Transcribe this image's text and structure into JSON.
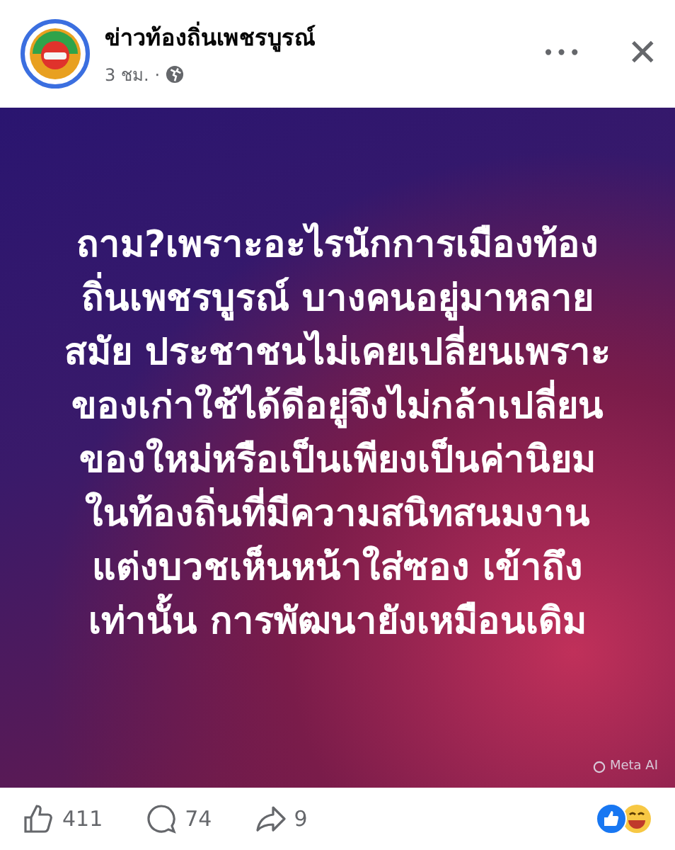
{
  "post": {
    "author": "ข่าวท้องถิ่นเพชรบูรณ์",
    "time": "3 ชม.",
    "separator": "·",
    "more": "•••",
    "close": "✕"
  },
  "image": {
    "lines": [
      "ถาม?เพราะอะไรนักการเมืองท้อง",
      "ถิ่นเพชรบูรณ์ บางคนอยู่มาหลาย",
      "สมัย ประชาชนไม่เคยเปลี่ยนเพราะ",
      "ของเก่าใช้ได้ดีอยู่จึงไม่กล้าเปลี่ยน",
      "ของใหม่หรือเป็นเพียงเป็นค่านิยม",
      "ในท้องถิ่นที่มีความสนิทสนมงาน",
      "แต่งบวชเห็นหน้าใส่ซอง เข้าถึง",
      "เท่านั้น การพัฒนายังเหมือนเดิม"
    ],
    "credit": "Meta AI"
  },
  "actions": [
    {
      "kind": "like",
      "count": "411"
    },
    {
      "kind": "comment",
      "count": "74"
    },
    {
      "kind": "share",
      "count": "9"
    }
  ]
}
